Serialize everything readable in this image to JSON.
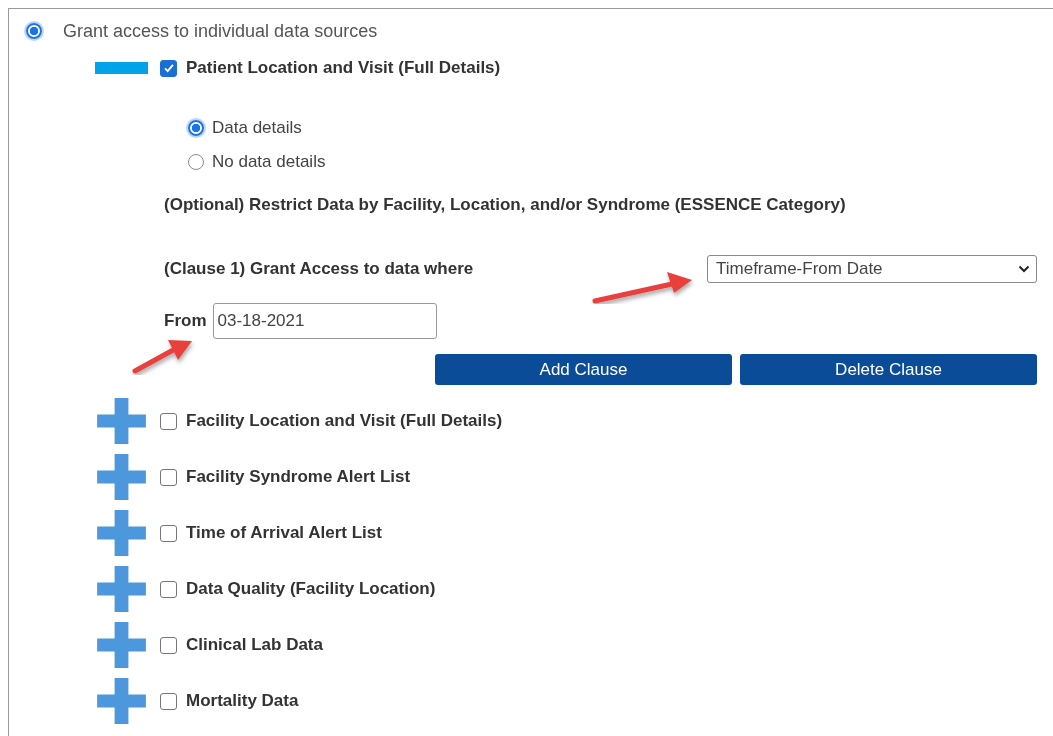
{
  "access_option": {
    "label": "Grant access to individual data sources",
    "selected": true
  },
  "sources": [
    {
      "label": "Patient Location and Visit (Full Details)",
      "checked": true,
      "expanded": true,
      "details": {
        "options": [
          {
            "label": "Data details",
            "selected": true
          },
          {
            "label": "No data details",
            "selected": false
          }
        ],
        "restrict_heading": "(Optional) Restrict Data by Facility, Location, and/or Syndrome (ESSENCE Category)",
        "clause_label": "(Clause 1) Grant Access to data where",
        "clause_select": {
          "value": "Timeframe-From Date"
        },
        "from_label": "From",
        "from_field": {
          "value": "03-18-2021"
        },
        "buttons": [
          "Add Clause",
          "Delete Clause"
        ]
      }
    },
    {
      "label": "Facility Location and Visit (Full Details)",
      "checked": false,
      "expanded": false
    },
    {
      "label": "Facility Syndrome Alert List",
      "checked": false,
      "expanded": false
    },
    {
      "label": "Time of Arrival Alert List",
      "checked": false,
      "expanded": false
    },
    {
      "label": "Data Quality (Facility Location)",
      "checked": false,
      "expanded": false
    },
    {
      "label": "Clinical Lab Data",
      "checked": false,
      "expanded": false
    },
    {
      "label": "Mortality Data",
      "checked": false,
      "expanded": false
    }
  ]
}
